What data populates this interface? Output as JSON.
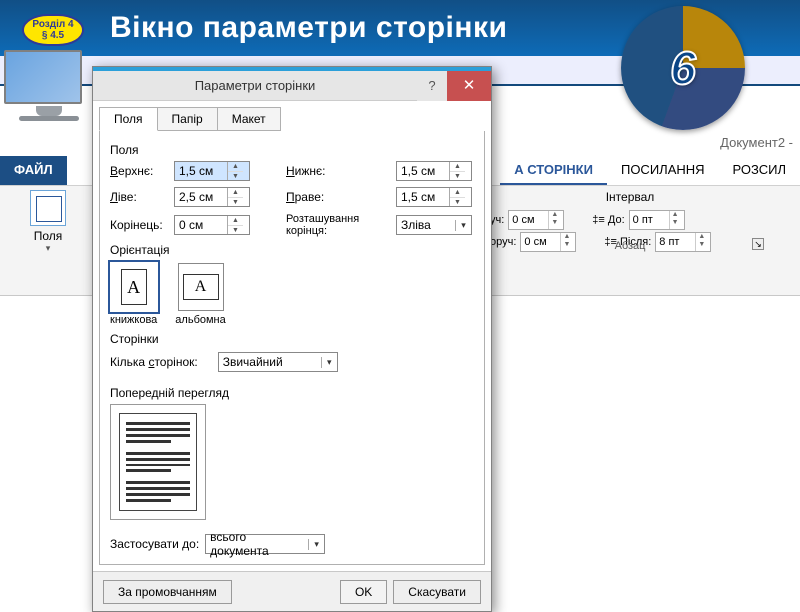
{
  "slide": {
    "title": "Вікно параметри сторінки",
    "chapter_line1": "Розділ 4",
    "chapter_line2": "§ 4.5",
    "badge_number": "6"
  },
  "word": {
    "doc_label": "Документ2 - ",
    "tabs": {
      "file": "ФАЙЛ",
      "active": "А СТОРІНКИ",
      "links": "ПОСИЛАННЯ",
      "mail": "РОЗСИЛ"
    },
    "polya_label": "Поля",
    "interval": {
      "header": "Інтервал",
      "left_label": "уч:",
      "left_val": "0 см",
      "right_label": "оруч:",
      "right_val": "0 см",
      "before_label": "До:",
      "before_val": "0 пт",
      "after_label": "Після:",
      "after_val": "8 пт",
      "section": "Абзац"
    }
  },
  "dialog": {
    "title": "Параметри сторінки",
    "tabs": {
      "fields": "Поля",
      "paper": "Папір",
      "layout": "Макет"
    },
    "margins": {
      "section": "Поля",
      "top_label": "Верхнє:",
      "top_val": "1,5 см",
      "bottom_label": "Нижнє:",
      "bottom_val": "1,5 см",
      "left_label": "Ліве:",
      "left_val": "2,5 см",
      "right_label": "Праве:",
      "right_val": "1,5 см",
      "gutter_label": "Корінець:",
      "gutter_val": "0 см",
      "gutter_pos_label": "Розташування корінця:",
      "gutter_pos_val": "Зліва"
    },
    "orientation": {
      "section": "Орієнтація",
      "portrait": "книжкова",
      "landscape": "альбомна",
      "glyph": "A"
    },
    "pages": {
      "section": "Сторінки",
      "multi_label": "Кілька сторінок:",
      "multi_val": "Звичайний"
    },
    "preview": {
      "section": "Попередній перегляд"
    },
    "apply": {
      "label": "Застосувати до:",
      "value": "всього документа"
    },
    "footer": {
      "default": "За промовчанням",
      "ok": "OK",
      "cancel": "Скасувати"
    }
  }
}
